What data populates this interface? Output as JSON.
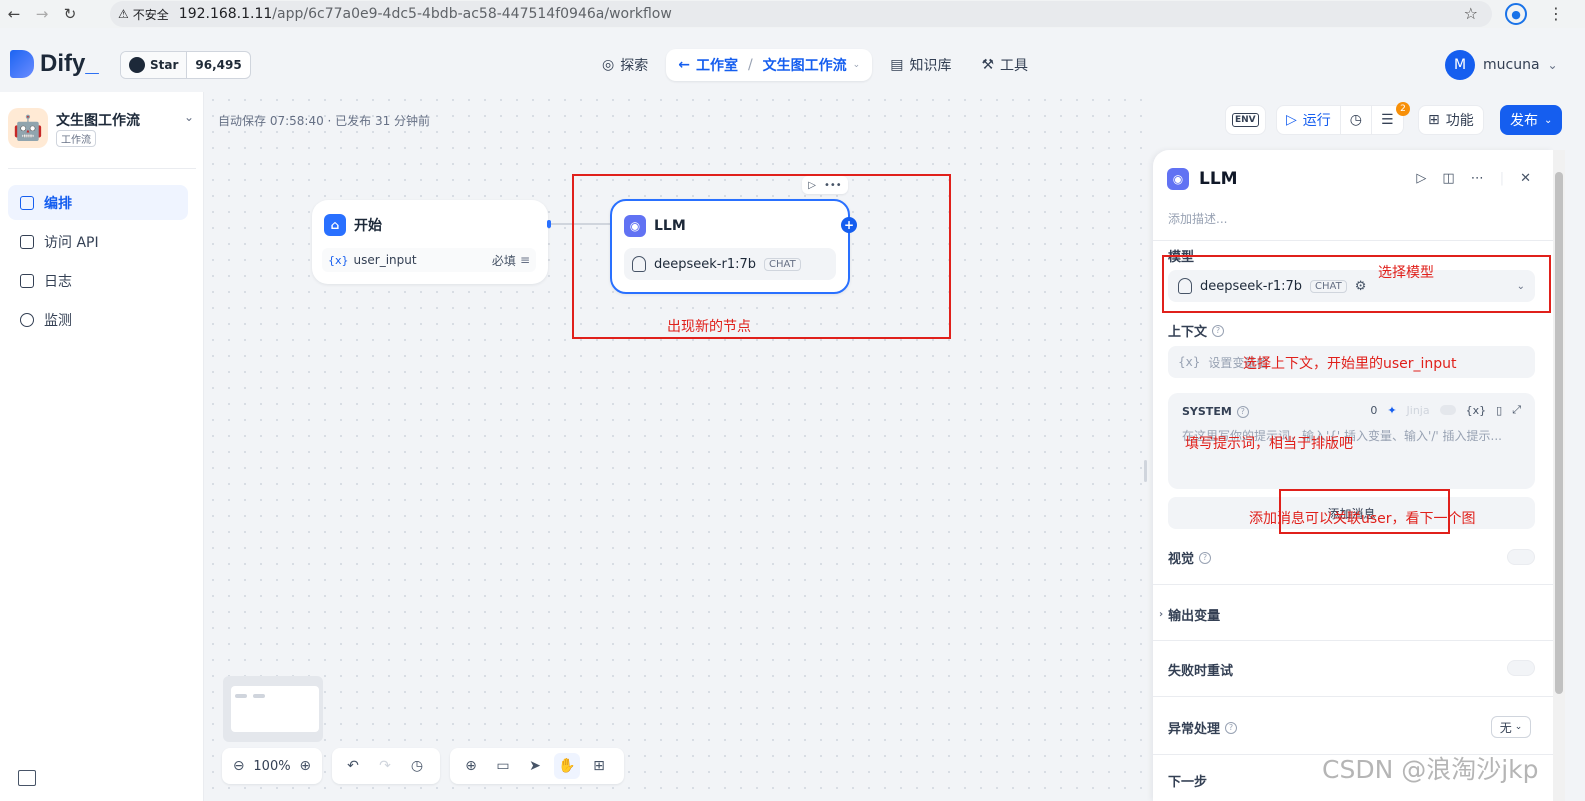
{
  "browser": {
    "insecure_label": "不安全",
    "url_host": "192.168.1.11",
    "url_path": "/app/6c77a0e9-4dc5-4bdb-ac58-447514f0946a/workflow"
  },
  "header": {
    "logo": "Dify",
    "github": {
      "star_label": "Star",
      "star_count": "96,495"
    },
    "nav": {
      "explore": "探索",
      "studio": "工作室",
      "current_app": "文生图工作流",
      "knowledge": "知识库",
      "tools": "工具"
    },
    "user": {
      "avatar_letter": "M",
      "name": "mucuna"
    }
  },
  "sidebar": {
    "app_name": "文生图工作流",
    "app_type": "工作流",
    "items": [
      {
        "label": "编排",
        "active": true
      },
      {
        "label": "访问 API",
        "active": false
      },
      {
        "label": "日志",
        "active": false
      },
      {
        "label": "监测",
        "active": false
      }
    ]
  },
  "canvas": {
    "autosave": "自动保存 07:58:40 · 已发布 31 分钟前",
    "start_node": {
      "title": "开始",
      "var_name": "user_input",
      "required": "必填"
    },
    "llm_node": {
      "title": "LLM",
      "model": "deepseek-r1:7b",
      "mode": "CHAT"
    },
    "zoom": "100%"
  },
  "toolbar": {
    "env": "ENV",
    "run": "运行",
    "checklist_badge": "2",
    "features": "功能",
    "publish": "发布"
  },
  "panel": {
    "title": "LLM",
    "description_placeholder": "添加描述...",
    "model_label": "模型",
    "model_name": "deepseek-r1:7b",
    "model_mode": "CHAT",
    "context_label": "上下文",
    "context_placeholder": "设置变量值",
    "system_label": "SYSTEM",
    "system_count": "0",
    "system_jinja": "Jinja",
    "system_placeholder": "在这里写你的提示词，输入'{' 插入变量、输入'/' 插入提示...",
    "add_message": "添加消息",
    "vision_label": "视觉",
    "output_vars_label": "输出变量",
    "retry_label": "失败时重试",
    "error_label": "异常处理",
    "error_value": "无",
    "next_step_label": "下一步"
  },
  "annotations": {
    "new_node": "出现新的节点",
    "select_model": "选择模型",
    "select_context": "选择上下文，开始里的user_input",
    "fill_prompt": "填写提示词，相当于排版吧",
    "add_message": "添加消息可以关联user，看下一个图"
  },
  "watermark": "CSDN @浪淘沙jkp",
  "colors": {
    "accent": "#155eef",
    "annotation": "#e0201b"
  }
}
